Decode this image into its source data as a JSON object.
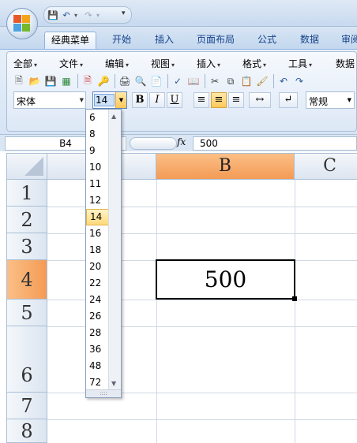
{
  "tabs": [
    {
      "label": "经典菜单",
      "active": true
    },
    {
      "label": "开始"
    },
    {
      "label": "插入"
    },
    {
      "label": "页面布局"
    },
    {
      "label": "公式"
    },
    {
      "label": "数据"
    },
    {
      "label": "审阅"
    }
  ],
  "menubar": [
    "全部",
    "文件",
    "编辑",
    "视图",
    "插入",
    "格式",
    "工具",
    "数据"
  ],
  "font": {
    "name": "宋体",
    "size": "14",
    "bold": "B",
    "italic": "I",
    "underline": "U",
    "number_format": "常规"
  },
  "size_options": [
    "6",
    "8",
    "9",
    "10",
    "11",
    "12",
    "14",
    "16",
    "18",
    "20",
    "22",
    "24",
    "26",
    "28",
    "36",
    "48",
    "72"
  ],
  "selected_size": "14",
  "formula_bar": {
    "name_box": "B4",
    "fx": "fx",
    "value": "500"
  },
  "sheet": {
    "columns": [
      "",
      "B",
      "C"
    ],
    "rows": [
      "1",
      "2",
      "3",
      "4",
      "5",
      "6",
      "7",
      "8"
    ],
    "active_cell": "B4",
    "cells": {
      "B4": "500"
    }
  },
  "icons": {
    "office_button": "office-logo-icon",
    "save": "save-icon",
    "undo": "undo-icon",
    "redo": "redo-icon"
  },
  "colors": {
    "selected_header": "#f49b56",
    "ribbon": "#d6e4f5",
    "accent": "#15428b"
  }
}
